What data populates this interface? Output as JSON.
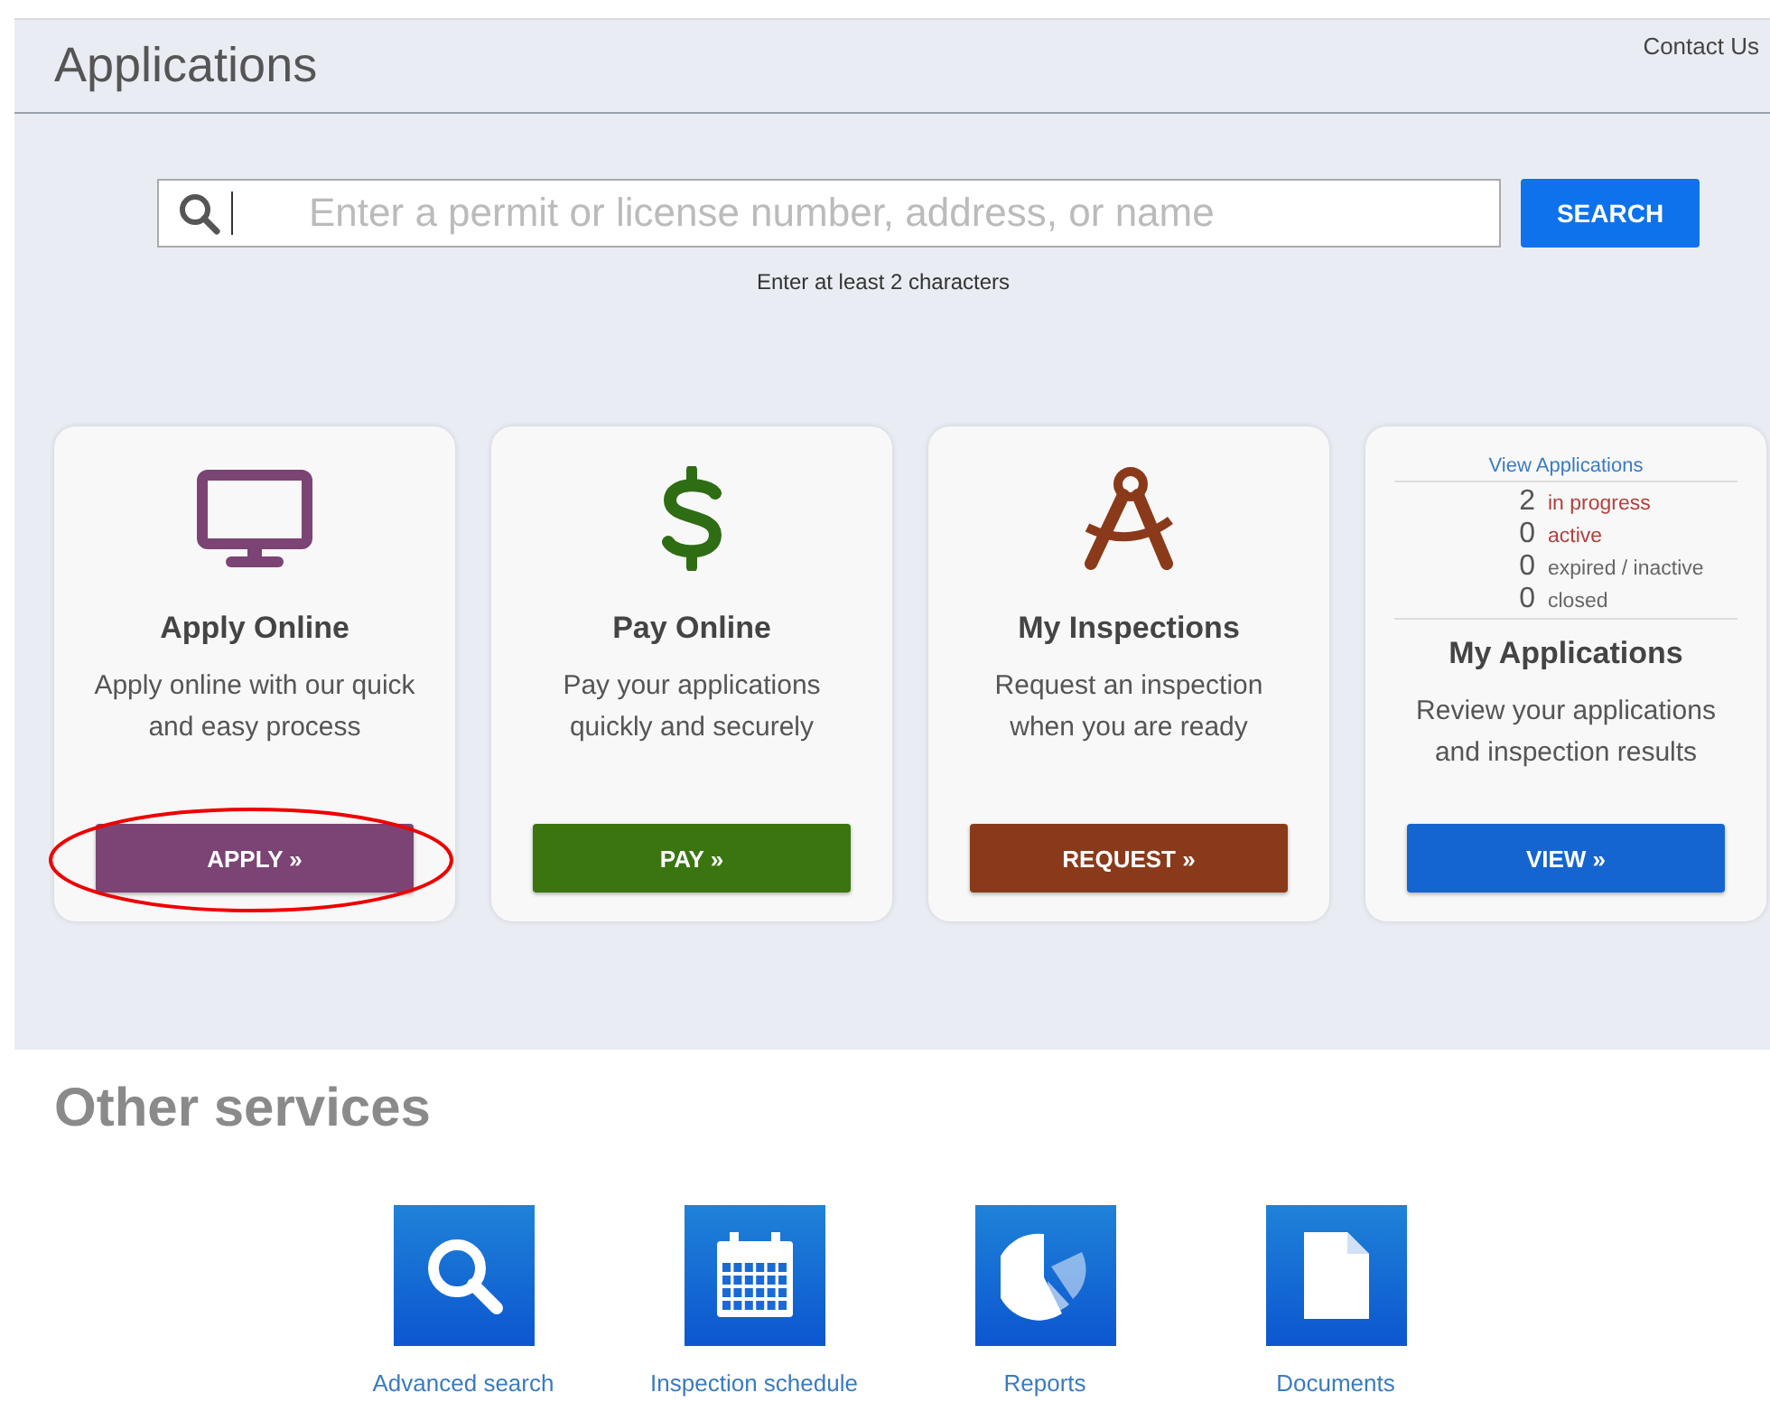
{
  "header": {
    "title": "Applications",
    "contact_link": "Contact Us"
  },
  "search": {
    "placeholder": "Enter a permit or license number, address, or name",
    "button": "SEARCH",
    "hint": "Enter at least 2 characters"
  },
  "cards": [
    {
      "kind": "action",
      "title": "Apply Online",
      "description": "Apply online with our quick and easy process",
      "button": "APPLY »",
      "color": "#7b4474",
      "circled": true
    },
    {
      "kind": "action",
      "title": "Pay Online",
      "description": "Pay your applications quickly and securely",
      "button": "PAY »",
      "color": "#3a7510",
      "circled": false
    },
    {
      "kind": "action",
      "title": "My Inspections",
      "description": "Request an inspection when you are ready",
      "button": "REQUEST »",
      "color": "#8a3a1a",
      "circled": false
    },
    {
      "kind": "summary",
      "link": "View Applications",
      "stats": [
        {
          "count": "2",
          "label": "in progress",
          "color": "#b0413e"
        },
        {
          "count": "0",
          "label": "active",
          "color": "#b0413e"
        },
        {
          "count": "0",
          "label": "expired / inactive",
          "color": "#666666"
        },
        {
          "count": "0",
          "label": "closed",
          "color": "#666666"
        }
      ],
      "title": "My Applications",
      "description": "Review your applications and inspection results",
      "button": "VIEW »",
      "color": "#1565d0",
      "circled": false
    }
  ],
  "other_services": {
    "title": "Other services",
    "items": [
      {
        "label": "Advanced search"
      },
      {
        "label": "Inspection schedule"
      },
      {
        "label": "Reports"
      },
      {
        "label": "Documents"
      }
    ]
  }
}
